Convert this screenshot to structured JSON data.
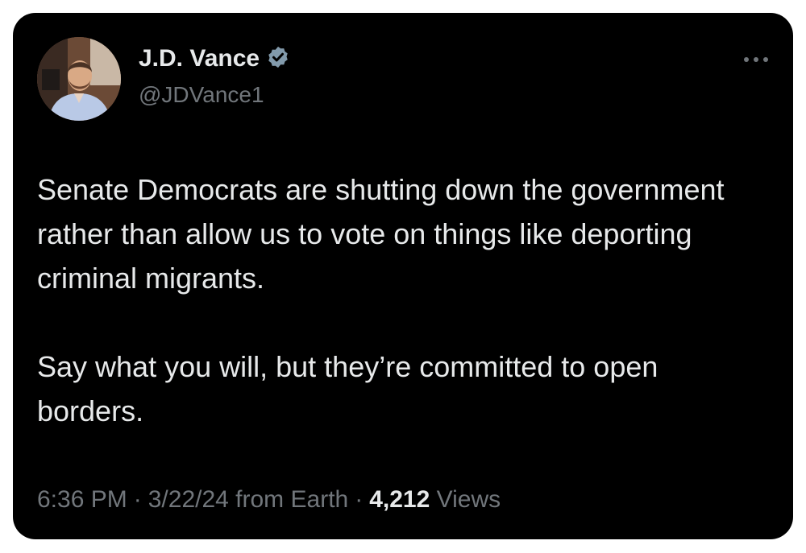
{
  "author": {
    "display_name": "J.D. Vance",
    "handle": "@JDVance1",
    "verified_icon": "verified-badge-icon"
  },
  "tweet": {
    "paragraph_1": "Senate Democrats are shutting down the government rather than allow us to vote on things like deporting criminal migrants.",
    "paragraph_2": "Say what you will, but they’re committed to open borders."
  },
  "meta": {
    "time": "6:36 PM",
    "separator": "·",
    "date": "3/22/24",
    "location": "from Earth",
    "views_count": "4,212",
    "views_label": "Views"
  },
  "colors": {
    "background": "#000000",
    "text": "#e7e9ea",
    "muted": "#71767b",
    "verified": "#829aab"
  }
}
